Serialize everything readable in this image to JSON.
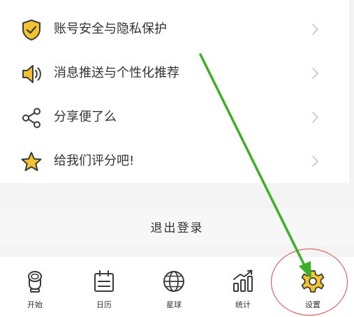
{
  "menu": {
    "items": [
      {
        "label": "账号安全与隐私保护",
        "icon": "shield-check-icon"
      },
      {
        "label": "消息推送与个性化推荐",
        "icon": "speaker-icon"
      },
      {
        "label": "分享便了么",
        "icon": "share-icon"
      },
      {
        "label": "给我们评分吧!",
        "icon": "star-icon"
      }
    ]
  },
  "logout": {
    "label": "退出登录"
  },
  "tabbar": {
    "tabs": [
      {
        "label": "开始",
        "icon": "toilet-icon"
      },
      {
        "label": "日历",
        "icon": "calendar-icon"
      },
      {
        "label": "星球",
        "icon": "globe-icon"
      },
      {
        "label": "统计",
        "icon": "stats-icon"
      },
      {
        "label": "设置",
        "icon": "gear-icon"
      }
    ]
  },
  "colors": {
    "accent": "#f4c430",
    "icon_stroke": "#3a3a3a",
    "annotation_arrow": "#3fae2a",
    "annotation_circle": "#d44c4c"
  }
}
